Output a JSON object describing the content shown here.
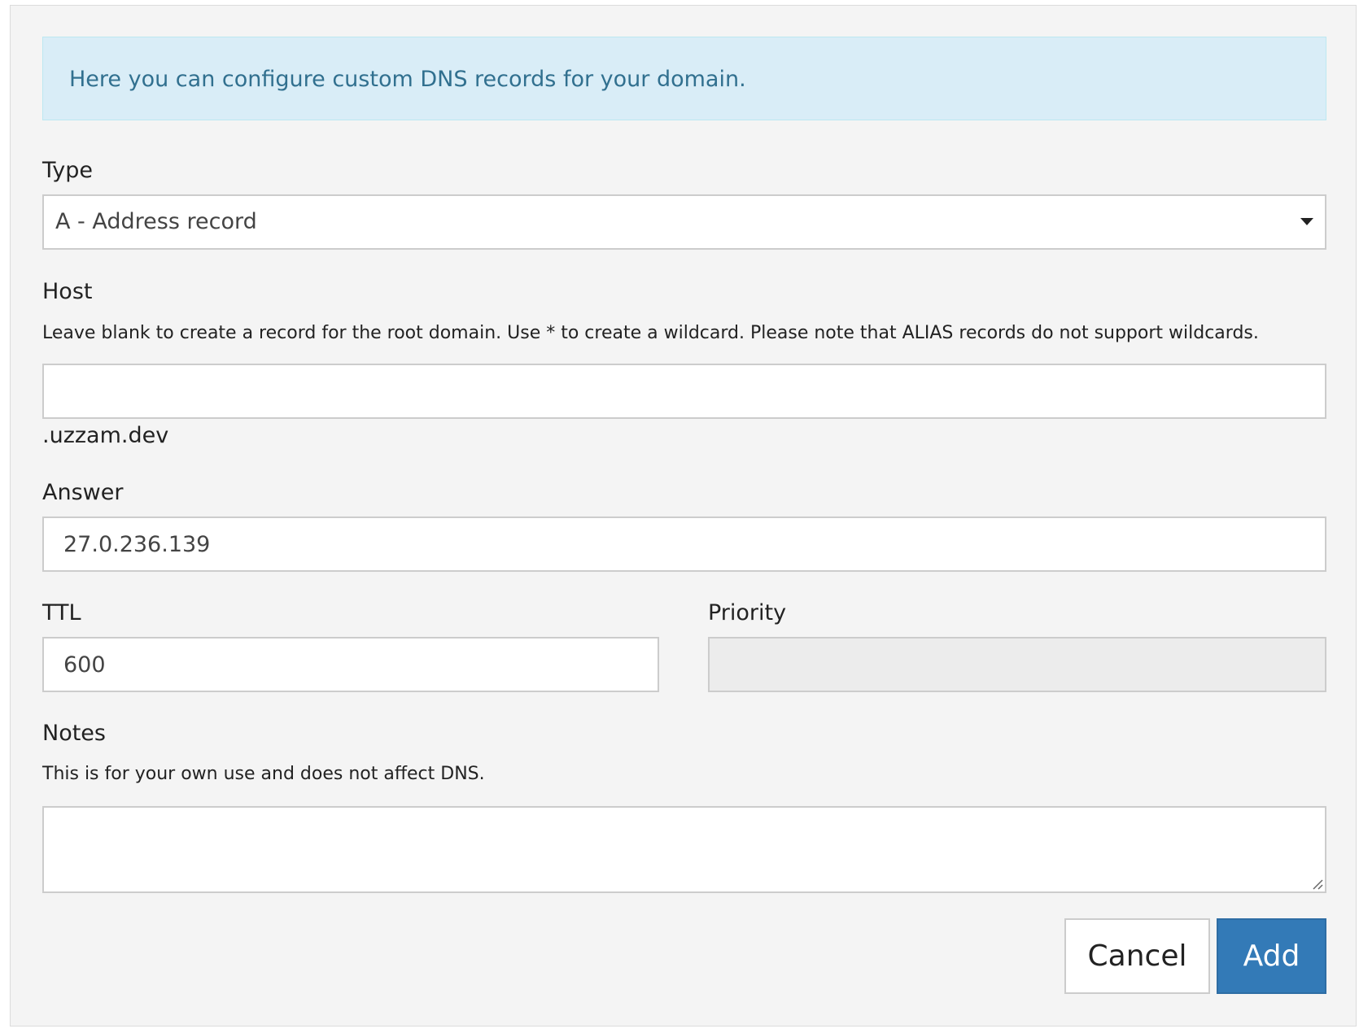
{
  "alert": {
    "text": "Here you can configure custom DNS records for your domain."
  },
  "form": {
    "type": {
      "label": "Type",
      "selected": "A - Address record"
    },
    "host": {
      "label": "Host",
      "help": "Leave blank to create a record for the root domain. Use * to create a wildcard. Please note that ALIAS records do not support wildcards.",
      "value": "",
      "suffix": ".uzzam.dev"
    },
    "answer": {
      "label": "Answer",
      "value": "27.0.236.139"
    },
    "ttl": {
      "label": "TTL",
      "value": "600"
    },
    "priority": {
      "label": "Priority",
      "value": "",
      "disabled": true
    },
    "notes": {
      "label": "Notes",
      "help": "This is for your own use and does not affect DNS.",
      "value": ""
    }
  },
  "actions": {
    "cancel_label": "Cancel",
    "add_label": "Add"
  },
  "colors": {
    "alert_bg": "#d9edf7",
    "alert_text": "#31708f",
    "primary": "#337ab7",
    "panel_bg": "#f4f4f4"
  },
  "icons": {
    "select_caret": "caret-down-icon",
    "textarea_grip": "resize-grip-icon"
  }
}
